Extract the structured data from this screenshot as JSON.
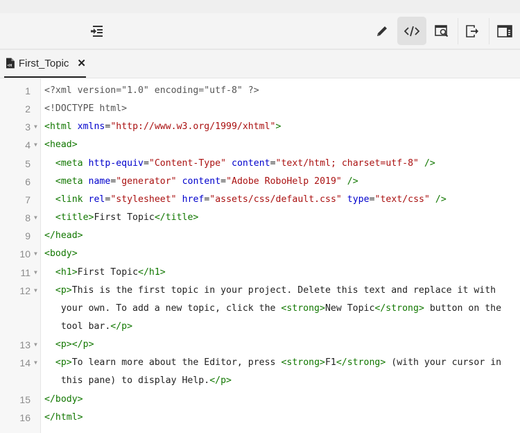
{
  "toolbar": {
    "left_buttons": [
      {
        "icon": "indent-icon",
        "label": "Toggle panel"
      }
    ],
    "right_buttons": [
      {
        "icon": "pencil-icon",
        "label": "Author view"
      },
      {
        "icon": "code-icon",
        "label": "Source view",
        "active": true
      },
      {
        "icon": "preview-icon",
        "label": "Preview"
      },
      {
        "icon": "export-icon",
        "label": "Export"
      },
      {
        "icon": "panel-icon",
        "label": "Toggle right panel"
      }
    ]
  },
  "tab": {
    "label": "First_Topic",
    "close": "✕",
    "icon": "html-file-icon"
  },
  "colors": {
    "tag": "#117700",
    "attr": "#0000cc",
    "string": "#aa1111",
    "text": "#222222",
    "gutter": "#f7f7f7"
  },
  "lines": [
    {
      "n": "1",
      "fold": false,
      "text": "<?xml version=\"1.0\" encoding=\"utf-8\" ?>"
    },
    {
      "n": "2",
      "fold": false,
      "text": "<!DOCTYPE html>"
    },
    {
      "n": "3",
      "fold": true,
      "text": "<html xmlns=\"http://www.w3.org/1999/xhtml\">"
    },
    {
      "n": "4",
      "fold": true,
      "text": "<head>"
    },
    {
      "n": "5",
      "fold": false,
      "text": "  <meta http-equiv=\"Content-Type\" content=\"text/html; charset=utf-8\" />"
    },
    {
      "n": "6",
      "fold": false,
      "text": "  <meta name=\"generator\" content=\"Adobe RoboHelp 2019\" />"
    },
    {
      "n": "7",
      "fold": false,
      "text": "  <link rel=\"stylesheet\" href=\"assets/css/default.css\" type=\"text/css\" />"
    },
    {
      "n": "8",
      "fold": true,
      "text": "  <title>First Topic</title>"
    },
    {
      "n": "9",
      "fold": false,
      "text": "</head>"
    },
    {
      "n": "10",
      "fold": true,
      "text": "<body>"
    },
    {
      "n": "11",
      "fold": true,
      "text": "  <h1>First Topic</h1>"
    },
    {
      "n": "12",
      "fold": true,
      "text": "  <p>This is the first topic in your project. Delete this text and replace it with",
      "wrap": [
        "   your own. To add a new topic, click the <strong>New Topic</strong> button on the",
        "   tool bar.</p>"
      ]
    },
    {
      "n": "13",
      "fold": true,
      "text": "  <p></p>"
    },
    {
      "n": "14",
      "fold": true,
      "text": "  <p>To learn more about the Editor, press <strong>F1</strong> (with your cursor in",
      "wrap": [
        "   this pane) to display Help.</p>"
      ]
    },
    {
      "n": "15",
      "fold": false,
      "text": "</body>"
    },
    {
      "n": "16",
      "fold": false,
      "text": "</html>"
    }
  ]
}
